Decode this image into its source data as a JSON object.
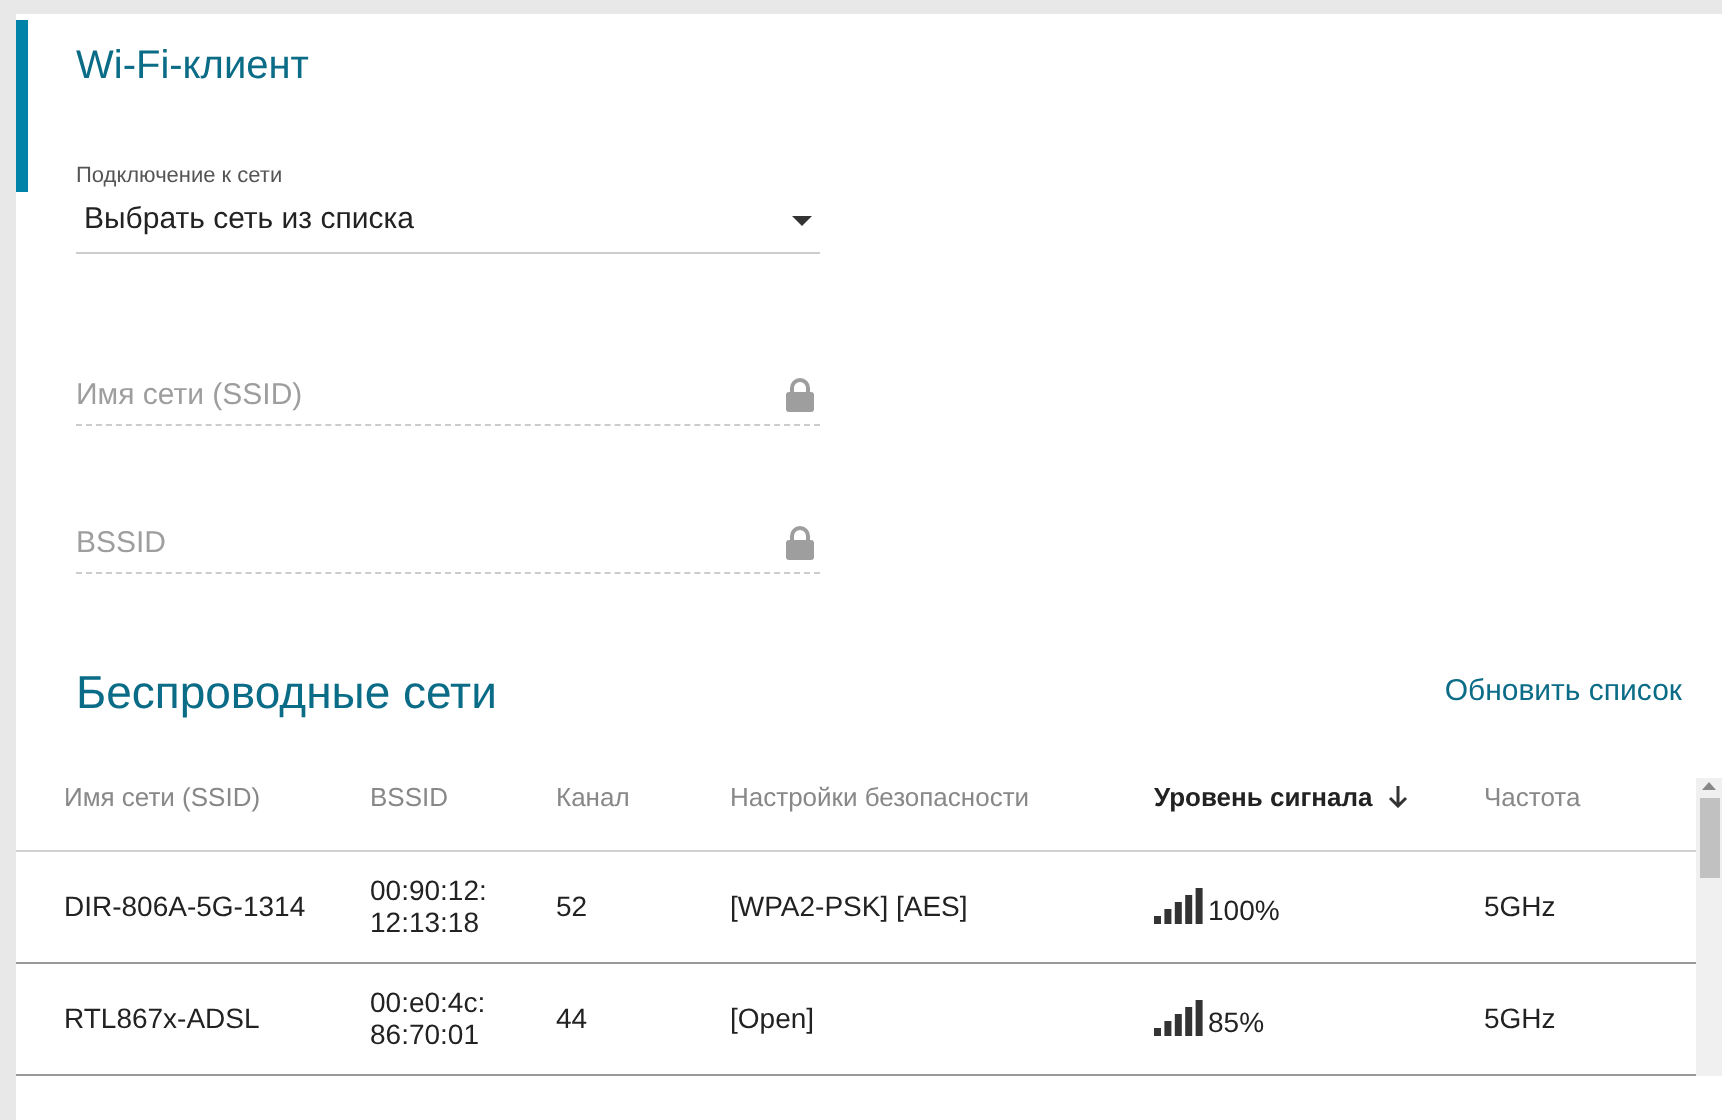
{
  "wifi_client": {
    "title": "Wi-Fi-клиент",
    "connection": {
      "label": "Подключение к сети",
      "value": "Выбрать сеть из списка"
    },
    "fields": [
      {
        "placeholder": "Имя сети (SSID)",
        "disabled": true
      },
      {
        "placeholder": "BSSID",
        "disabled": true
      }
    ]
  },
  "networks": {
    "title": "Беспроводные сети",
    "refresh_link": "Обновить список",
    "columns": [
      {
        "label": "Имя сети (SSID)",
        "sorted": false
      },
      {
        "label": "BSSID",
        "sorted": false
      },
      {
        "label": "Канал",
        "sorted": false
      },
      {
        "label": "Настройки безопасности",
        "sorted": false
      },
      {
        "label": "Уровень сигнала",
        "sorted": true
      },
      {
        "label": "Частота",
        "sorted": false
      }
    ],
    "rows": [
      {
        "ssid": "DIR-806A-5G-1314",
        "bssid": [
          "00:90:12:",
          "12:13:18"
        ],
        "channel": "52",
        "security": "[WPA2-PSK] [AES]",
        "signal": "100%",
        "frequency": "5GHz"
      },
      {
        "ssid": "RTL867x-ADSL",
        "bssid": [
          "00:e0:4c:",
          "86:70:01"
        ],
        "channel": "44",
        "security": "[Open]",
        "signal": "85%",
        "frequency": "5GHz"
      }
    ]
  }
}
